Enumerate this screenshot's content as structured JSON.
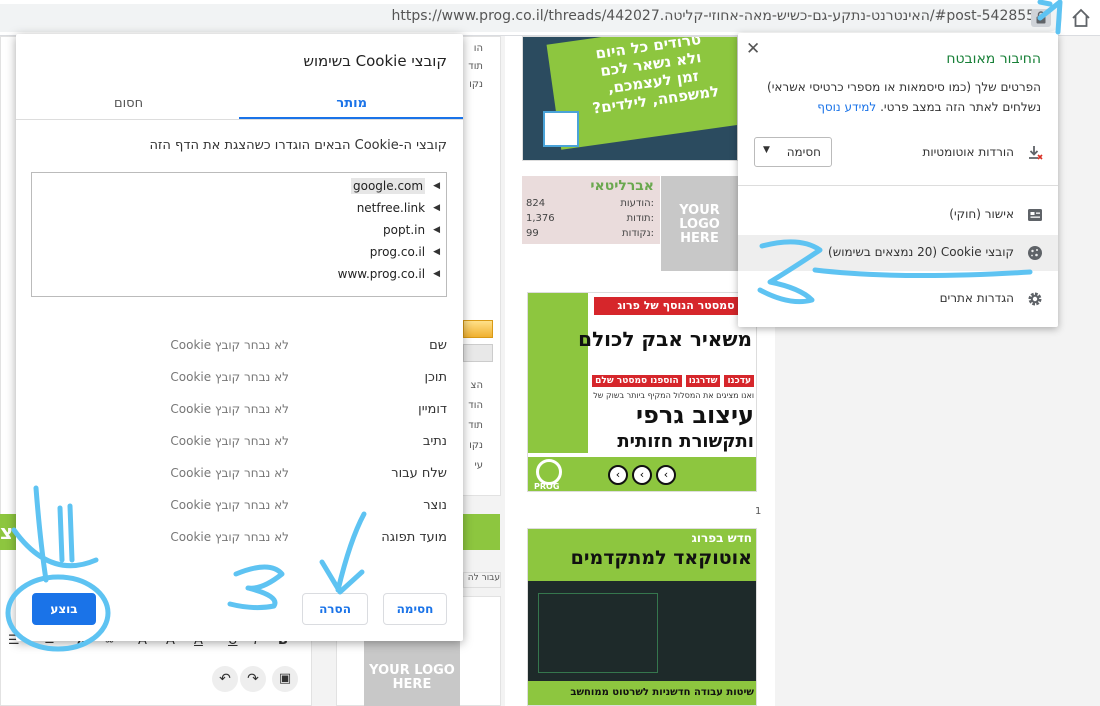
{
  "browser": {
    "url": "https://www.prog.co.il/threads/442027.האינטרנט-נתקע-גם-כשיש-מאה-אחוזי-קליטה/#post-5428550"
  },
  "background": {
    "forum_stats": {
      "username": "אברליטאי",
      "rows": [
        {
          "label": "הודעות:",
          "value": "824"
        },
        {
          "label": "תודות:",
          "value": "1,376"
        },
        {
          "label": "נקודות:",
          "value": "99"
        }
      ]
    },
    "logo_placeholder": "YOUR LOGO HERE",
    "ad_top": {
      "lines": [
        "טרודים כל היום",
        "ולא נשאר לכם",
        "זמן לעצמכם,",
        "למשפחה, לילדים?"
      ]
    },
    "ad_middle": {
      "header": "סמסטר הנוסף של פרוג",
      "headline": "משאיר אבק לכולם",
      "tags": [
        "עדכנו",
        "שדרגנו",
        "הוספנו סמסטר שלם"
      ],
      "small": "ואנו מציגים את המסלול המקיף ביותר בשוק של",
      "big1": "עיצוב גרפי",
      "big2": "ותקשורת חזותית",
      "brand": "PROG"
    },
    "ad_bottom": {
      "top": "חדש בפרוג",
      "headline": "אוטוקאד למתקדמים",
      "footer": "שיטות עבודה חדשניות לשרטוט ממוחשב"
    },
    "left_snippets": [
      "הו",
      "תוד",
      "נקו"
    ],
    "left_snippets_mid": [
      "הצ",
      "הוד",
      "תוד",
      "נקו",
      "עי"
    ],
    "page_number": "1",
    "left_green_text": "צ",
    "left_small_text": "עבור לה"
  },
  "cookie_dialog": {
    "title": "קובצי Cookie בשימוש",
    "tabs": [
      "מותר",
      "חסום"
    ],
    "description": "קובצי ה-Cookie הבאים הוגדרו כשהצגת את הדף הזה",
    "sites": [
      "google.com",
      "netfree.link",
      "popt.in",
      "prog.co.il",
      "www.prog.co.il"
    ],
    "fields": [
      {
        "label": "שם",
        "value": "לא נבחר קובץ Cookie"
      },
      {
        "label": "תוכן",
        "value": "לא נבחר קובץ Cookie"
      },
      {
        "label": "דומיין",
        "value": "לא נבחר קובץ Cookie"
      },
      {
        "label": "נתיב",
        "value": "לא נבחר קובץ Cookie"
      },
      {
        "label": "שלח עבור",
        "value": "לא נבחר קובץ Cookie"
      },
      {
        "label": "נוצר",
        "value": "לא נבחר קובץ Cookie"
      },
      {
        "label": "מועד תפוגה",
        "value": "לא נבחר קובץ Cookie"
      }
    ],
    "buttons": {
      "block": "חסימה",
      "remove": "הסרה",
      "done": "בוצע"
    }
  },
  "site_info": {
    "title": "החיבור מאובטח",
    "close": "✕",
    "description": "הפרטים שלך (כמו סיסמאות או מספרי כרטיסי אשראי) נשלחים לאתר הזה במצב פרטי.",
    "learn_more": "למידע נוסף",
    "downloads_label": "הורדות אוטומטיות",
    "downloads_value": "חסימה",
    "certificate": "אישור (חוקי)",
    "cookies": "קובצי Cookie (20 נמצאים בשימוש)",
    "site_settings": "הגדרות אתרים"
  },
  "colors": {
    "accent": "#1a73e8",
    "secure_green": "#188038",
    "annotation": "#5ec3f2",
    "ad_green": "#8dc63f"
  }
}
